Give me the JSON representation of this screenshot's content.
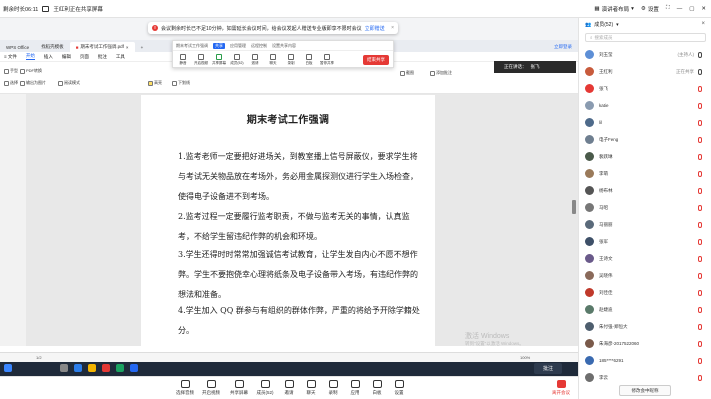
{
  "topbar": {
    "meeting_time": "剩余时长06:11",
    "sharing_label": "王红利正在共享屏幕",
    "speaker_layout": "演讲者布局",
    "settings": "设置",
    "window_min": "—",
    "window_max": "▢",
    "window_close": "✕"
  },
  "notice": {
    "text": "会议剩余时长已不足10分钟，如需延长会议时间，给会议发起人赠送专业版即享不限时会议",
    "link": "立即赠送"
  },
  "wps": {
    "tabs": [
      "WPS Office",
      "找稻壳模板",
      "期末考试工作强调.pdf"
    ],
    "menu": [
      "开始",
      "插入",
      "编辑",
      "页面",
      "批注",
      "工具"
    ],
    "tools": [
      "手型",
      "选择",
      "PDF转换",
      "输出为图片",
      "阅读模式",
      "高亮",
      "下划线",
      "删除线",
      "文字批注",
      "形状批注",
      "添加批注",
      "截图"
    ],
    "right_buttons": [
      "立即登录"
    ]
  },
  "meeting_bar": {
    "title": "期末考试工作强调",
    "badge": "共享",
    "items": [
      "静音",
      "开启视频",
      "共享屏幕",
      "成员(52)",
      "邀请",
      "聊天",
      "录制",
      "白板",
      "暂停共享"
    ],
    "tabs": [
      "应用管理",
      "远程控制",
      "设置共享内容"
    ],
    "stop_label": "结束共享"
  },
  "speaker": {
    "label": "正在讲话：",
    "name": "张飞"
  },
  "document": {
    "title": "期末考试工作强调",
    "paragraphs": [
      "1.监考老师一定要把好进场关，到教室播上信号屏蔽仪，要求学生将与考试无关物品放在考场外，务必用金属探测仪进行学生入场检查，使得电子设备进不到考场。",
      "2.监考过程一定要履行监考职责，不做与监考无关的事情，认真监考，不给学生留违纪作弊的机会和环境。",
      "3.学生还得时时常常加强诚信考试教育，让学生发自内心不愿不想作弊。学生不要抱侥幸心理将纸条及电子设备带入考场，有违纪作弊的想法和准备。",
      "4.学生加入 QQ 群参与有组织的群体作弊，严重的将给予开除学籍处分。"
    ]
  },
  "statusbar": {
    "page": "1/2",
    "zoom": "100%"
  },
  "watermark": {
    "line1": "激活 Windows",
    "line2": "转到\"设置\"以激活 Windows。"
  },
  "taskbar": {
    "annotate": "批注"
  },
  "bottom_toolbar": {
    "items": [
      "选择音频",
      "开启视频",
      "共享屏幕",
      "成员(52)",
      "邀请",
      "聊天",
      "录制",
      "应用",
      "白板",
      "设置"
    ],
    "end": "离开会议"
  },
  "panel": {
    "title": "成员(52)",
    "search_placeholder": "搜索成员",
    "members": [
      {
        "name": "刘玉莹",
        "sub": "(主持人)",
        "color": "#5d8fd6"
      },
      {
        "name": "王红利",
        "sub": "正在共享",
        "color": "#c85b3c"
      },
      {
        "name": "张飞",
        "sub": "",
        "color": "#e53935"
      },
      {
        "name": "katie",
        "sub": "",
        "color": "#8a9bb0"
      },
      {
        "name": "lil",
        "sub": "",
        "color": "#4e6a8a"
      },
      {
        "name": "电子Feng",
        "sub": "",
        "color": "#6f7f90"
      },
      {
        "name": "裴跃琳",
        "sub": "",
        "color": "#4a5a4a"
      },
      {
        "name": "李萌",
        "sub": "",
        "color": "#9a7a5a"
      },
      {
        "name": "杨布林",
        "sub": "",
        "color": "#555"
      },
      {
        "name": "马昭",
        "sub": "",
        "color": "#777"
      },
      {
        "name": "马丽丽",
        "sub": "",
        "color": "#5a6a7a"
      },
      {
        "name": "张军",
        "sub": "",
        "color": "#3e5068"
      },
      {
        "name": "王诗文",
        "sub": "",
        "color": "#6a5a8a"
      },
      {
        "name": "吴晓伟",
        "sub": "",
        "color": "#8a6a5a"
      },
      {
        "name": "刘佳佳",
        "sub": "",
        "color": "#c0392b"
      },
      {
        "name": "赵婕迪",
        "sub": "",
        "color": "#5a7a6a"
      },
      {
        "name": "朱付强-郑恒大",
        "sub": "",
        "color": "#4e5e6e"
      },
      {
        "name": "朱海彦-2017522060",
        "sub": "",
        "color": "#7a5a4a"
      },
      {
        "name": "185****6291",
        "sub": "",
        "color": "#3a6ab0"
      },
      {
        "name": "李云",
        "sub": "",
        "color": "#6e6e6e"
      }
    ],
    "bottom_button": "修改会中昵称"
  }
}
